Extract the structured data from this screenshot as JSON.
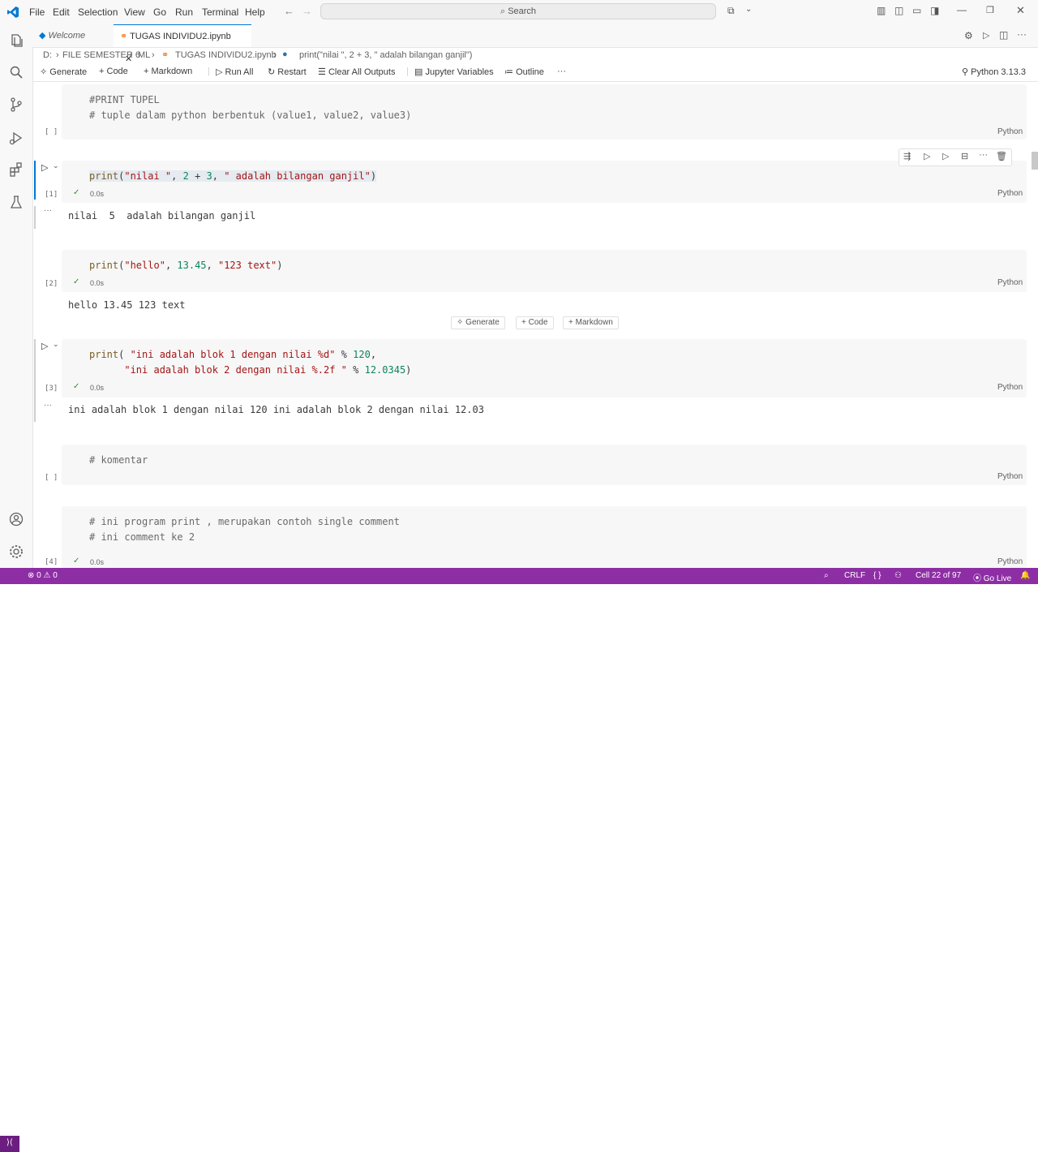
{
  "menu": [
    "File",
    "Edit",
    "Selection",
    "View",
    "Go",
    "Run",
    "Terminal",
    "Help"
  ],
  "search_placeholder": "Search",
  "tabs": [
    {
      "label": "Welcome"
    },
    {
      "label": "TUGAS INDIVIDU2.ipynb"
    }
  ],
  "breadcrumb": [
    "D:",
    "FILE SEMESTER 6",
    "ML",
    "TUGAS INDIVIDU2.ipynb",
    "print(\"nilai \", 2 + 3, \" adalah bilangan ganjil\")"
  ],
  "toolbar": {
    "generate": "Generate",
    "code": "Code",
    "markdown": "Markdown",
    "run_all": "Run All",
    "restart": "Restart",
    "clear_all_outputs": "Clear All Outputs",
    "jupyter_variables": "Jupyter Variables",
    "outline": "Outline",
    "more": "···",
    "kernel": "Python 3.13.3"
  },
  "cells": [
    {
      "exec": "[ ]",
      "lines": [
        "#PRINT TUPEL",
        "# tuple dalam python berbentuk (value1, value2, value3)"
      ],
      "lang": "Python"
    },
    {
      "exec": "[1]",
      "timing": "0.0s",
      "lang": "Python",
      "output": "nilai  5  adalah bilangan ganjil"
    },
    {
      "exec": "[2]",
      "timing": "0.0s",
      "lang": "Python",
      "output": "hello 13.45 123 text"
    },
    {
      "exec": "[3]",
      "timing": "0.0s",
      "lang": "Python",
      "output": "ini adalah blok 1 dengan nilai 120 ini adalah blok 2 dengan nilai 12.03"
    },
    {
      "exec": "[ ]",
      "lines": [
        "# komentar"
      ],
      "lang": "Python"
    },
    {
      "exec": "[4]",
      "timing": "0.0s",
      "lang": "Python",
      "lines": [
        "# ini program print , merupakan contoh single comment",
        "# ini comment ke 2"
      ]
    }
  ],
  "insert_chips": {
    "generate": "Generate",
    "code": "Code",
    "markdown": "Markdown"
  },
  "output_dots": "···",
  "status": {
    "errors": "0",
    "warnings": "0",
    "eol": "CRLF",
    "braces": "{ }",
    "cell": "Cell 22 of 97",
    "golive": "Go Live"
  },
  "colors": {
    "accent": "#0078d4",
    "statusbar": "#8e2ea5"
  }
}
